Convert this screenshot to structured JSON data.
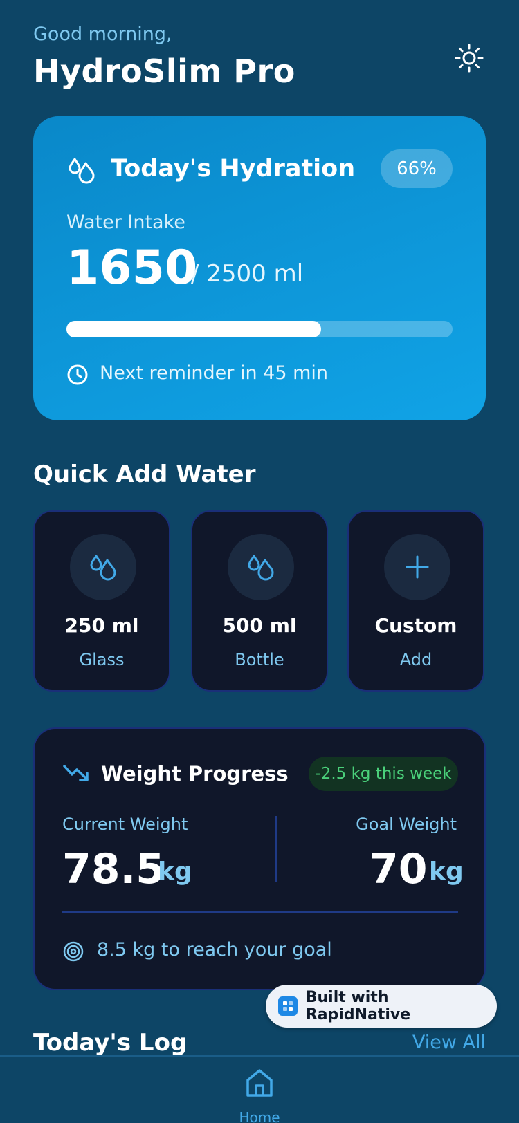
{
  "header": {
    "greeting": "Good morning,",
    "title": "HydroSlim Pro",
    "theme_icon": "sun-icon"
  },
  "hydration": {
    "title": "Today's Hydration",
    "percent_label": "66%",
    "intake_label": "Water Intake",
    "intake_value": "1650",
    "intake_goal": "/ 2500 ml",
    "progress_fraction": 0.66,
    "reminder": "Next reminder in 45 min"
  },
  "quick_add": {
    "title": "Quick Add Water",
    "items": [
      {
        "amount": "250 ml",
        "label": "Glass",
        "icon": "water-drops-icon"
      },
      {
        "amount": "500 ml",
        "label": "Bottle",
        "icon": "water-drops-icon"
      },
      {
        "amount": "Custom",
        "label": "Add",
        "icon": "plus-icon"
      }
    ]
  },
  "weight": {
    "title": "Weight Progress",
    "weekly_change": "-2.5 kg this week",
    "current_label": "Current Weight",
    "current_value": "78.5",
    "current_unit": "kg",
    "goal_label": "Goal Weight",
    "goal_value": "70",
    "goal_unit": "kg",
    "remaining": "8.5 kg to reach your goal"
  },
  "badge": {
    "text": "Built with RapidNative"
  },
  "log": {
    "title": "Today's Log",
    "view_all": "View All"
  },
  "nav": {
    "home_label": "Home"
  },
  "colors": {
    "background": "#0d4566",
    "accent": "#42a9e8",
    "card_dark": "#10172a",
    "success": "#4ad07a"
  }
}
